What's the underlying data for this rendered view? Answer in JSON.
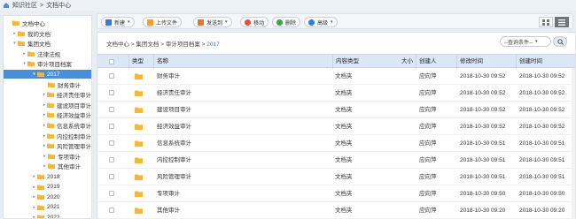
{
  "breadcrumb": {
    "part1": "知识社区",
    "sep": ">",
    "part2": "文档中心"
  },
  "tree": [
    {
      "label": "文档中心",
      "toggle": "",
      "level": 0,
      "icon": "folder-open"
    },
    {
      "label": "我的文档",
      "toggle": "▸",
      "level": 1,
      "icon": "folder"
    },
    {
      "label": "集团文档",
      "toggle": "▾",
      "level": 1,
      "icon": "folder-open"
    },
    {
      "label": "法律法规",
      "toggle": "▸",
      "level": 2,
      "icon": "folder"
    },
    {
      "label": "审计项目档案",
      "toggle": "▾",
      "level": 2,
      "icon": "folder-open"
    },
    {
      "label": "2017",
      "toggle": "▾",
      "level": 3,
      "icon": "folder-open",
      "selected": true
    },
    {
      "label": "财务审计",
      "toggle": "",
      "level": 4,
      "icon": "folder"
    },
    {
      "label": "经济责任审计",
      "toggle": "▸",
      "level": 4,
      "icon": "folder"
    },
    {
      "label": "建设项目审计",
      "toggle": "▸",
      "level": 4,
      "icon": "folder"
    },
    {
      "label": "经济效益审计",
      "toggle": "▸",
      "level": 4,
      "icon": "folder"
    },
    {
      "label": "信息系统审计",
      "toggle": "▸",
      "level": 4,
      "icon": "folder"
    },
    {
      "label": "内控控制审计",
      "toggle": "▸",
      "level": 4,
      "icon": "folder"
    },
    {
      "label": "风险管理审计",
      "toggle": "▸",
      "level": 4,
      "icon": "folder"
    },
    {
      "label": "专项审计",
      "toggle": "▸",
      "level": 4,
      "icon": "folder"
    },
    {
      "label": "其他审计",
      "toggle": "▸",
      "level": 4,
      "icon": "folder"
    },
    {
      "label": "2018",
      "toggle": "▸",
      "level": 3,
      "icon": "folder"
    },
    {
      "label": "2019",
      "toggle": "▸",
      "level": 3,
      "icon": "folder"
    },
    {
      "label": "2020",
      "toggle": "▸",
      "level": 3,
      "icon": "folder"
    },
    {
      "label": "2021",
      "toggle": "▸",
      "level": 3,
      "icon": "folder"
    },
    {
      "label": "2022",
      "toggle": "▸",
      "level": 3,
      "icon": "folder"
    }
  ],
  "toolbar": {
    "new_label": "新建",
    "upload_label": "上传文件",
    "send_label": "发送到",
    "move_label": "移动",
    "delete_label": "删除",
    "advanced_label": "高级"
  },
  "path": {
    "p1": "文档中心",
    "p2": "集团文档",
    "p3": "审计项目档案",
    "p4": "2017",
    "sep": ">"
  },
  "query": {
    "label": "--查询条件--"
  },
  "table": {
    "headers": {
      "type": "类型",
      "name": "名称",
      "content_type": "内容类型",
      "size": "大小",
      "creator": "创建人",
      "modified": "修改时间",
      "created": "创建时间"
    },
    "rows": [
      {
        "name": "财务审计",
        "content_type": "文档夹",
        "size": "",
        "creator": "应向萍",
        "modified": "2018-10-30 09:52",
        "created": "2018-10-30 09:52"
      },
      {
        "name": "经济责任审计",
        "content_type": "文档夹",
        "size": "",
        "creator": "应向萍",
        "modified": "2018-10-30 09:52",
        "created": "2018-10-30 09:52"
      },
      {
        "name": "建设项目审计",
        "content_type": "文档夹",
        "size": "",
        "creator": "应向萍",
        "modified": "2018-10-30 09:52",
        "created": "2018-10-30 09:52"
      },
      {
        "name": "经济效益审计",
        "content_type": "文档夹",
        "size": "",
        "creator": "应向萍",
        "modified": "2018-10-30 09:52",
        "created": "2018-10-30 09:52"
      },
      {
        "name": "信息系统审计",
        "content_type": "文档夹",
        "size": "",
        "creator": "应向萍",
        "modified": "2018-10-30 09:51",
        "created": "2018-10-30 09:51"
      },
      {
        "name": "内控控制审计",
        "content_type": "文档夹",
        "size": "",
        "creator": "应向萍",
        "modified": "2018-10-30 09:51",
        "created": "2018-10-30 09:51"
      },
      {
        "name": "风险管理审计",
        "content_type": "文档夹",
        "size": "",
        "creator": "应向萍",
        "modified": "2018-10-30 09:51",
        "created": "2018-10-30 09:51"
      },
      {
        "name": "专项审计",
        "content_type": "文档夹",
        "size": "",
        "creator": "应向萍",
        "modified": "2018-10-30 09:50",
        "created": "2018-10-30 09:50"
      },
      {
        "name": "其他审计",
        "content_type": "文档夹",
        "size": "",
        "creator": "应向萍",
        "modified": "2018-10-30 09:20",
        "created": "2018-10-30 09:20"
      }
    ]
  },
  "colors": {
    "accent": "#4a8fd6",
    "folder": "#f5b73b",
    "header_bg": "#dbe7f5",
    "link": "#3a7bd5"
  }
}
